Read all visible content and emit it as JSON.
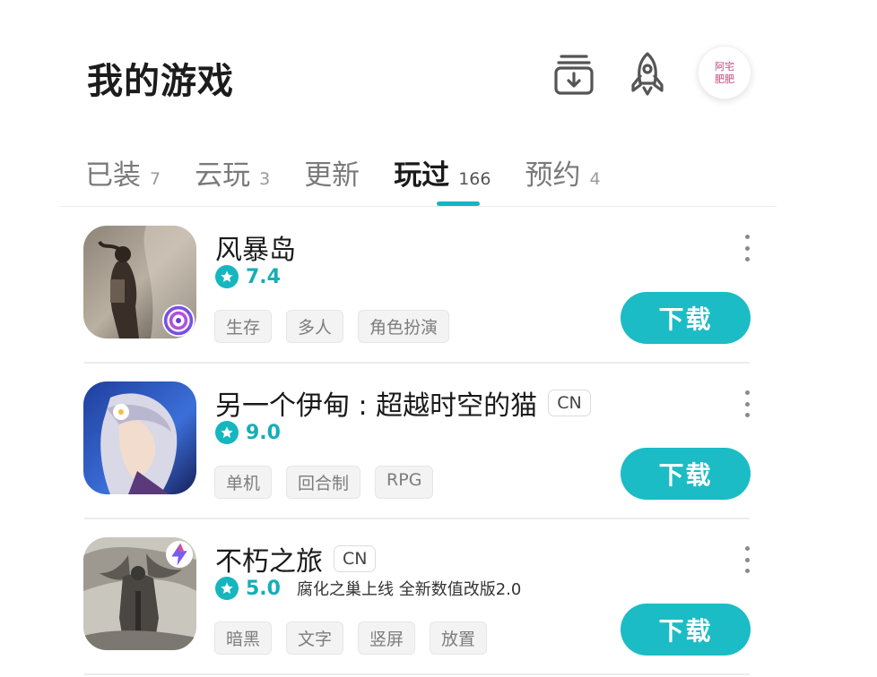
{
  "header": {
    "title": "我的游戏",
    "avatar_text": "阿宅 肥肥",
    "icons": [
      "download-manager-icon",
      "rocket-icon",
      "avatar"
    ]
  },
  "tabs": [
    {
      "label": "已装",
      "count": "7"
    },
    {
      "label": "云玩",
      "count": "3"
    },
    {
      "label": "更新",
      "count": ""
    },
    {
      "label": "玩过",
      "count": "166",
      "active": true
    },
    {
      "label": "预约",
      "count": "4"
    }
  ],
  "games": [
    {
      "name": "风暴岛",
      "region": "",
      "score": "7.4",
      "promo": "",
      "tags": [
        "生存",
        "多人",
        "角色扮演"
      ],
      "action": "下载"
    },
    {
      "name": "另一个伊甸 : 超越时空的猫",
      "region": "CN",
      "score": "9.0",
      "promo": "",
      "tags": [
        "单机",
        "回合制",
        "RPG"
      ],
      "action": "下载"
    },
    {
      "name": "不朽之旅",
      "region": "CN",
      "score": "5.0",
      "promo": "腐化之巢上线 全新数值改版2.0",
      "tags": [
        "暗黑",
        "文字",
        "竖屏",
        "放置"
      ],
      "action": "下载"
    }
  ],
  "colors": {
    "accent": "#1bbcc5",
    "score": "#15aeb7",
    "tab_indicator": "#15b6bf"
  }
}
